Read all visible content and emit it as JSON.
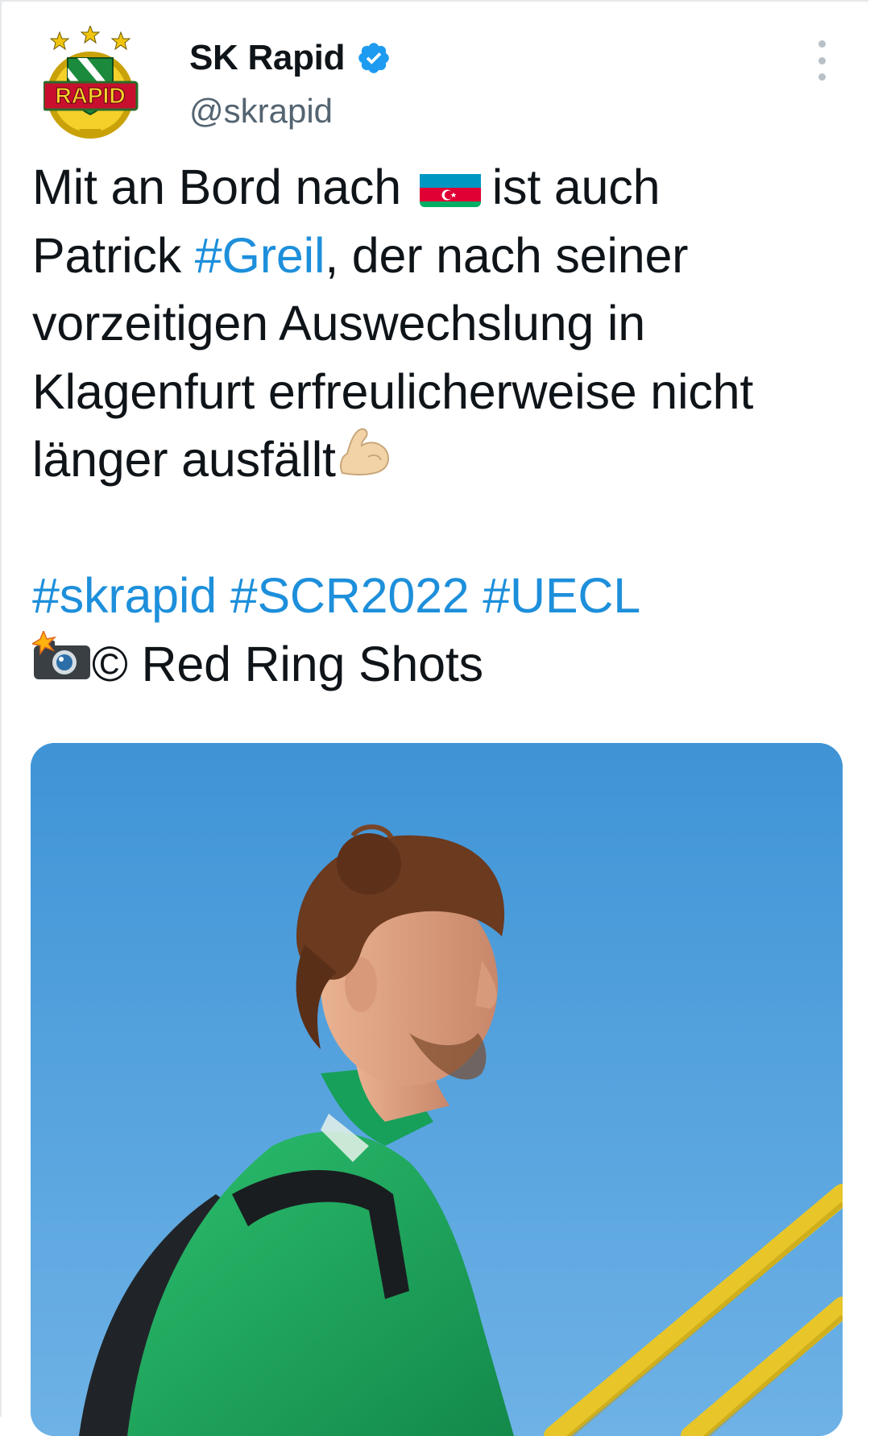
{
  "tweet": {
    "author": {
      "display_name": "SK Rapid",
      "handle": "@skrapid",
      "verified": true,
      "avatar_icon": "sk-rapid-crest-icon",
      "avatar_logo_text": "RAPID"
    },
    "menu_icon": "more-options-icon",
    "text": {
      "line1_before": "Mit an Bord nach",
      "line1_flag_icon": "azerbaijan-flag-icon",
      "line1_after": "ist auch",
      "line2_before": "Patrick ",
      "line2_hashtag": "#Greil",
      "line2_after": ", der nach seiner",
      "line3": "vorzeitigen Auswechslung in",
      "line4": "Klagenfurt erfreulicherweise nicht",
      "line5": "länger ausfällt",
      "line5_emoji_icon": "flexed-biceps-icon",
      "hashtags": [
        "#skrapid",
        "#SCR2022",
        "#UECL"
      ],
      "credit_emoji_icon": "camera-flash-icon",
      "credit": "© Red Ring Shots"
    },
    "media": {
      "icon": "player-photo",
      "description_colors": {
        "sky": "#4a9ad8",
        "jacket": "#1fa15b",
        "railing": "#e8c62a"
      }
    }
  },
  "colors": {
    "text": "#0f1419",
    "secondary": "#536471",
    "link": "#1d8fdb",
    "verified": "#1d9bf0"
  }
}
